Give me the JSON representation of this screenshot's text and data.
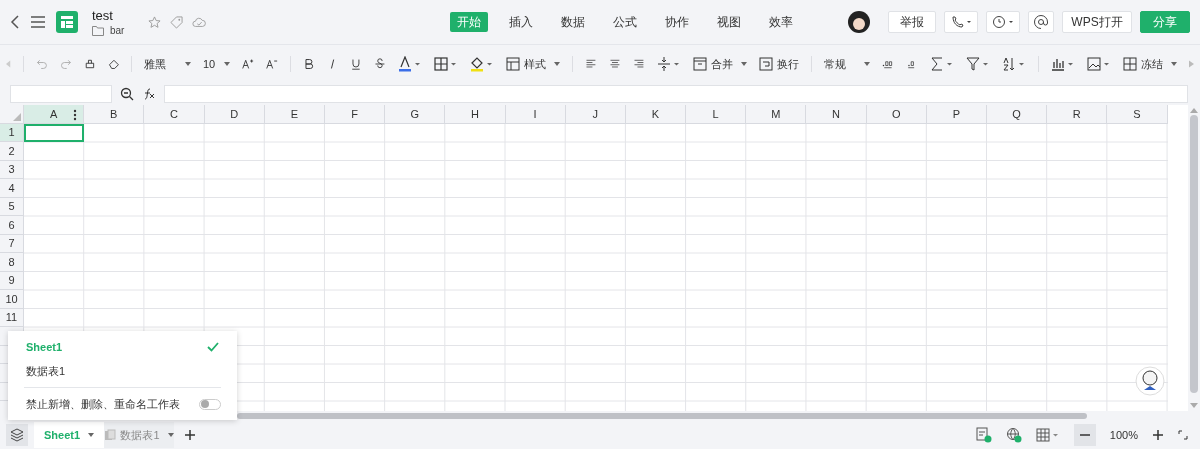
{
  "document": {
    "title": "test",
    "folder": "bar"
  },
  "menu_tabs": [
    {
      "label": "开始",
      "selected": true
    },
    {
      "label": "插入",
      "selected": false
    },
    {
      "label": "数据",
      "selected": false
    },
    {
      "label": "公式",
      "selected": false
    },
    {
      "label": "协作",
      "selected": false
    },
    {
      "label": "视图",
      "selected": false
    },
    {
      "label": "效率",
      "selected": false
    }
  ],
  "header_buttons": {
    "report": "举报",
    "open_wps": "WPS打开",
    "share": "分享"
  },
  "toolbar": {
    "font": "雅黑",
    "size": "10",
    "style": "样式",
    "merge": "合并",
    "wrap": "换行",
    "format": "常规",
    "freeze": "冻结"
  },
  "columns": [
    {
      "label": "A",
      "selected": true
    },
    {
      "label": "B",
      "selected": false
    },
    {
      "label": "C",
      "selected": false
    },
    {
      "label": "D",
      "selected": false
    },
    {
      "label": "E",
      "selected": false
    },
    {
      "label": "F",
      "selected": false
    },
    {
      "label": "G",
      "selected": false
    },
    {
      "label": "H",
      "selected": false
    },
    {
      "label": "I",
      "selected": false
    },
    {
      "label": "J",
      "selected": false
    },
    {
      "label": "K",
      "selected": false
    },
    {
      "label": "L",
      "selected": false
    },
    {
      "label": "M",
      "selected": false
    },
    {
      "label": "N",
      "selected": false
    },
    {
      "label": "O",
      "selected": false
    },
    {
      "label": "P",
      "selected": false
    },
    {
      "label": "Q",
      "selected": false
    },
    {
      "label": "R",
      "selected": false
    },
    {
      "label": "S",
      "selected": false
    }
  ],
  "rows": [
    {
      "label": "1",
      "selected": true
    },
    {
      "label": "2",
      "selected": false
    },
    {
      "label": "3",
      "selected": false
    },
    {
      "label": "4",
      "selected": false
    },
    {
      "label": "5",
      "selected": false
    },
    {
      "label": "6",
      "selected": false
    },
    {
      "label": "7",
      "selected": false
    },
    {
      "label": "8",
      "selected": false
    },
    {
      "label": "9",
      "selected": false
    },
    {
      "label": "10",
      "selected": false
    },
    {
      "label": "11",
      "selected": false
    }
  ],
  "sheet_menu": {
    "items": [
      {
        "label": "Sheet1",
        "selected": true
      },
      {
        "label": "数据表1",
        "selected": false
      }
    ],
    "lock_label": "禁止新增、删除、重命名工作表",
    "lock_on": false
  },
  "sheet_tabs": [
    {
      "label": "Sheet1",
      "selected": true
    },
    {
      "label": "数据表1",
      "selected": false
    }
  ],
  "status_bar": {
    "zoom": "100%"
  }
}
